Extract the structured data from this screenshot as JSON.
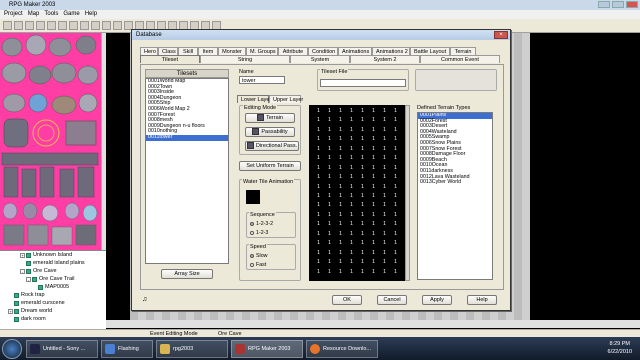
{
  "app": {
    "title": "RPG Maker 2003",
    "menu": [
      "Project",
      "Map",
      "Tools",
      "Game",
      "Help"
    ]
  },
  "map_tree": {
    "items": [
      {
        "label": "Unknown Island",
        "level": 2,
        "expand": "+"
      },
      {
        "label": "emerald island plains",
        "level": 2,
        "expand": ""
      },
      {
        "label": "Ore Cave",
        "level": 2,
        "expand": "-"
      },
      {
        "label": "Ore Cave Trail",
        "level": 3,
        "expand": "-"
      },
      {
        "label": "MAP0005",
        "level": 4,
        "expand": ""
      },
      {
        "label": "Rock trap",
        "level": 1,
        "expand": ""
      },
      {
        "label": "emerald curscene",
        "level": 1,
        "expand": ""
      },
      {
        "label": "Dream world",
        "level": 1,
        "expand": "+"
      },
      {
        "label": "dark room",
        "level": 1,
        "expand": ""
      }
    ]
  },
  "status": {
    "mode": "Event Editing Mode",
    "map": "Ore Cave"
  },
  "database": {
    "title": "Database",
    "close": "×",
    "tabs_row1": [
      "Hero",
      "Class",
      "Skill",
      "Item",
      "Monster",
      "M. Groups",
      "Attribute",
      "Condition",
      "Animations",
      "Animations 2",
      "Battle Layout",
      "Terrain"
    ],
    "tabs_row2": [
      "Tileset",
      "String",
      "System",
      "System 2",
      "Common Event"
    ],
    "tilesets": {
      "header": "Tilesets",
      "items": [
        "0001World Map",
        "0002Town",
        "0003Inside",
        "0004Dungeon",
        "0005Ship",
        "0006World Map 2",
        "0007Forest",
        "0008mesh",
        "0009Dungeon n-u floors",
        "0010nothing",
        "0011tower"
      ],
      "selected_index": 10,
      "array_size": "Array Size"
    },
    "name_label": "Name",
    "name_value": "tower",
    "tileset_file_label": "Tileset File",
    "tileset_file_value": "",
    "layer_tabs": [
      "Lower Layer",
      "Upper Layer"
    ],
    "editing_mode": {
      "title": "Editing Mode",
      "buttons": [
        "Terrain",
        "Passability",
        "Directional Pass."
      ]
    },
    "set_uniform": "Set Uniform Terrain",
    "water_anim": {
      "title": "Water Tile Animation",
      "sequence_title": "Sequence",
      "sequence_options": [
        "1-2-3-2",
        "1-2-3"
      ],
      "speed_title": "Speed",
      "speed_options": [
        "Slow",
        "Fast"
      ]
    },
    "terrain_value": "1",
    "terrain_types": {
      "header": "Defined Terrain Types",
      "items": [
        "0001Plains",
        "0002Forest",
        "0003Desert",
        "0004Wasteland",
        "0005Swamp",
        "0006Snow Plains",
        "0007Snow Forest",
        "0008Damage Floor",
        "0009Beach",
        "0010Ocean",
        "0011darkness",
        "0012Lava Wasteland",
        "0013Cyber World"
      ],
      "selected_index": 0
    },
    "footer": {
      "ok": "OK",
      "cancel": "Cancel",
      "apply": "Apply",
      "help": "Help"
    }
  },
  "taskbar": {
    "tasks": [
      "Untitled - Sony ...",
      "Flashing",
      "rpg2003",
      "RPG Maker 2003",
      "Resource Downlo..."
    ],
    "time": "8:29 PM",
    "date": "6/22/2010"
  },
  "colors": {
    "palette_bg": "#ff3ea5",
    "selection": "#3d6fd2",
    "title_bar": "#c9d9ea"
  }
}
